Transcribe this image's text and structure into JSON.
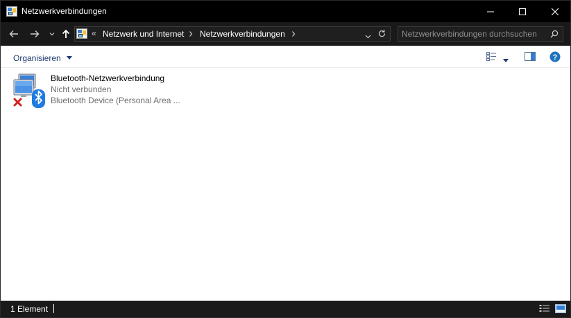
{
  "window": {
    "title": "Netzwerkverbindungen",
    "title_icon": "network-connections-icon"
  },
  "address": {
    "overflow": "«",
    "crumbs": [
      "Netzwerk und Internet",
      "Netzwerkverbindungen"
    ]
  },
  "search": {
    "placeholder": "Netzwerkverbindungen durchsuchen"
  },
  "toolbar": {
    "organize_label": "Organisieren"
  },
  "items": [
    {
      "name": "Bluetooth-Netzwerkverbindung",
      "status": "Nicht verbunden",
      "device": "Bluetooth Device (Personal Area ..."
    }
  ],
  "statusbar": {
    "count": "1 Element"
  },
  "colors": {
    "titlebar": "#000000",
    "addressbar": "#191919",
    "accent_blue": "#1e73be",
    "error_red": "#d4201c"
  }
}
